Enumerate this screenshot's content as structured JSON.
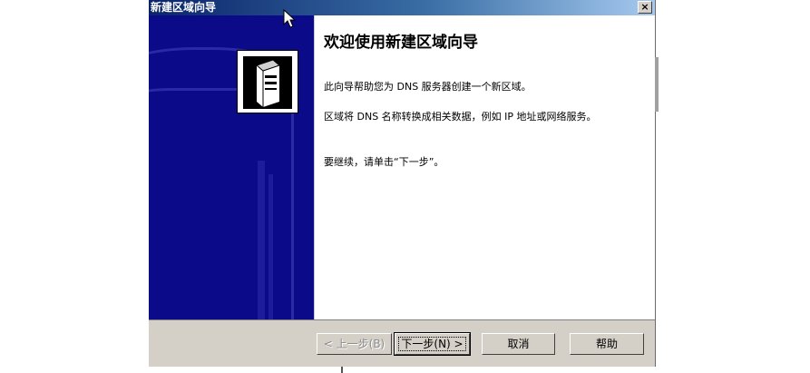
{
  "window": {
    "title": "新建区域向导",
    "close_glyph": "×"
  },
  "content": {
    "heading": "欢迎使用新建区域向导",
    "para1": "此向导帮助您为 DNS 服务器创建一个新区域。",
    "para2": "区域将 DNS 名称转换成相关数据，例如 IP 地址或网络服务。",
    "para3": "要继续，请单击“下一步”。"
  },
  "buttons": {
    "back": "< 上一步(B)",
    "next": "下一步(N) >",
    "cancel": "取消",
    "help": "帮助"
  },
  "colors": {
    "sidebar": "#0b0b8a",
    "titlebar_start": "#0a246a",
    "footer": "#d4d0c8"
  },
  "icons": {
    "wizard": "server-icon",
    "cursor": "mouse-pointer-icon"
  }
}
